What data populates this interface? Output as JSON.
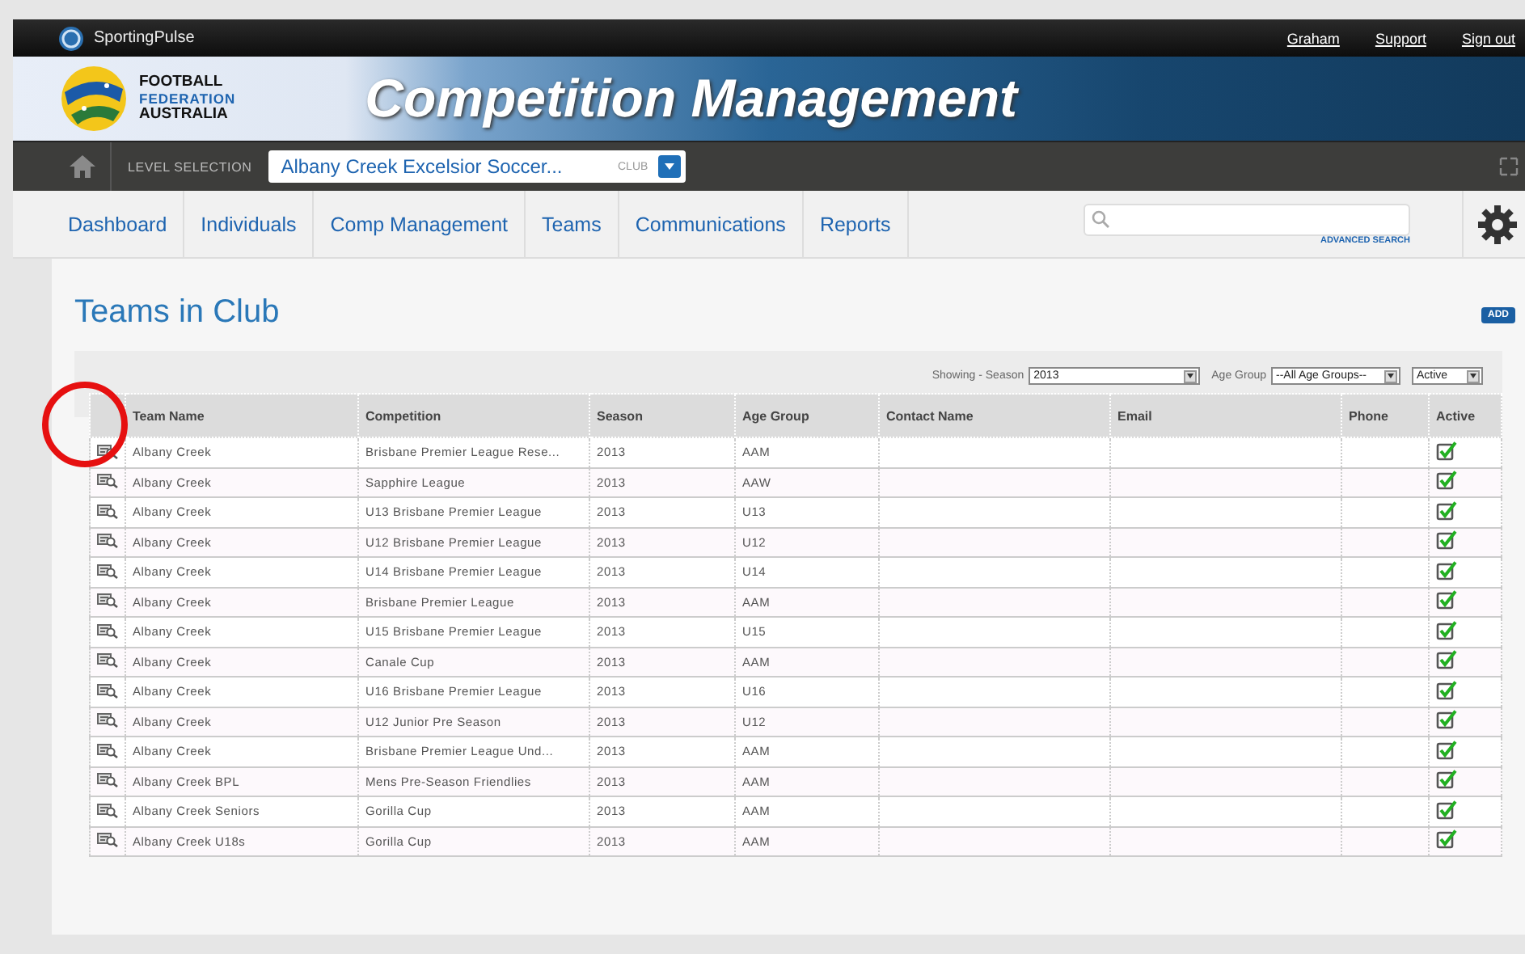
{
  "topbar": {
    "brand": "SportingPulse",
    "links": [
      "Graham",
      "Support",
      "Sign out"
    ]
  },
  "banner": {
    "logo_lines": [
      "FOOTBALL",
      "FEDERATION",
      "AUSTRALIA"
    ],
    "title": "Competition Management"
  },
  "level_bar": {
    "label": "LEVEL SELECTION",
    "selected_value": "Albany Creek Excelsior Soccer...",
    "level_type": "CLUB"
  },
  "nav": {
    "items": [
      "Dashboard",
      "Individuals",
      "Comp Management",
      "Teams",
      "Communications",
      "Reports"
    ],
    "search": {
      "link": "ADVANCED SEARCH"
    }
  },
  "page": {
    "title": "Teams in Club",
    "add_button": "ADD"
  },
  "filters": {
    "label": "Showing - Season",
    "season": "2013",
    "age_label": "Age Group",
    "age_group": "--All Age Groups--",
    "status": "Active"
  },
  "table": {
    "columns": [
      "Team Name",
      "Competition",
      "Season",
      "Age Group",
      "Contact Name",
      "Email",
      "Phone",
      "Active"
    ],
    "rows": [
      {
        "team": "Albany Creek",
        "competition": "Brisbane Premier League Rese...",
        "season": "2013",
        "age_group": "AAM",
        "active": true
      },
      {
        "team": "Albany Creek",
        "competition": "Sapphire League",
        "season": "2013",
        "age_group": "AAW",
        "active": true
      },
      {
        "team": "Albany Creek",
        "competition": "U13 Brisbane Premier League",
        "season": "2013",
        "age_group": "U13",
        "active": true
      },
      {
        "team": "Albany Creek",
        "competition": "U12 Brisbane Premier League",
        "season": "2013",
        "age_group": "U12",
        "active": true
      },
      {
        "team": "Albany Creek",
        "competition": "U14 Brisbane Premier League",
        "season": "2013",
        "age_group": "U14",
        "active": true
      },
      {
        "team": "Albany Creek",
        "competition": "Brisbane Premier League",
        "season": "2013",
        "age_group": "AAM",
        "active": true
      },
      {
        "team": "Albany Creek",
        "competition": "U15 Brisbane Premier League",
        "season": "2013",
        "age_group": "U15",
        "active": true
      },
      {
        "team": "Albany Creek",
        "competition": "Canale Cup",
        "season": "2013",
        "age_group": "AAM",
        "active": true
      },
      {
        "team": "Albany Creek",
        "competition": "U16 Brisbane Premier League",
        "season": "2013",
        "age_group": "U16",
        "active": true
      },
      {
        "team": "Albany Creek",
        "competition": "U12 Junior Pre Season",
        "season": "2013",
        "age_group": "U12",
        "active": true
      },
      {
        "team": "Albany Creek",
        "competition": "Brisbane Premier League Und...",
        "season": "2013",
        "age_group": "AAM",
        "active": true
      },
      {
        "team": "Albany Creek BPL",
        "competition": "Mens Pre-Season Friendlies",
        "season": "2013",
        "age_group": "AAM",
        "active": true
      },
      {
        "team": "Albany Creek Seniors",
        "competition": "Gorilla Cup",
        "season": "2013",
        "age_group": "AAM",
        "active": true
      },
      {
        "team": "Albany Creek U18s",
        "competition": "Gorilla Cup",
        "season": "2013",
        "age_group": "AAM",
        "active": true
      }
    ]
  }
}
